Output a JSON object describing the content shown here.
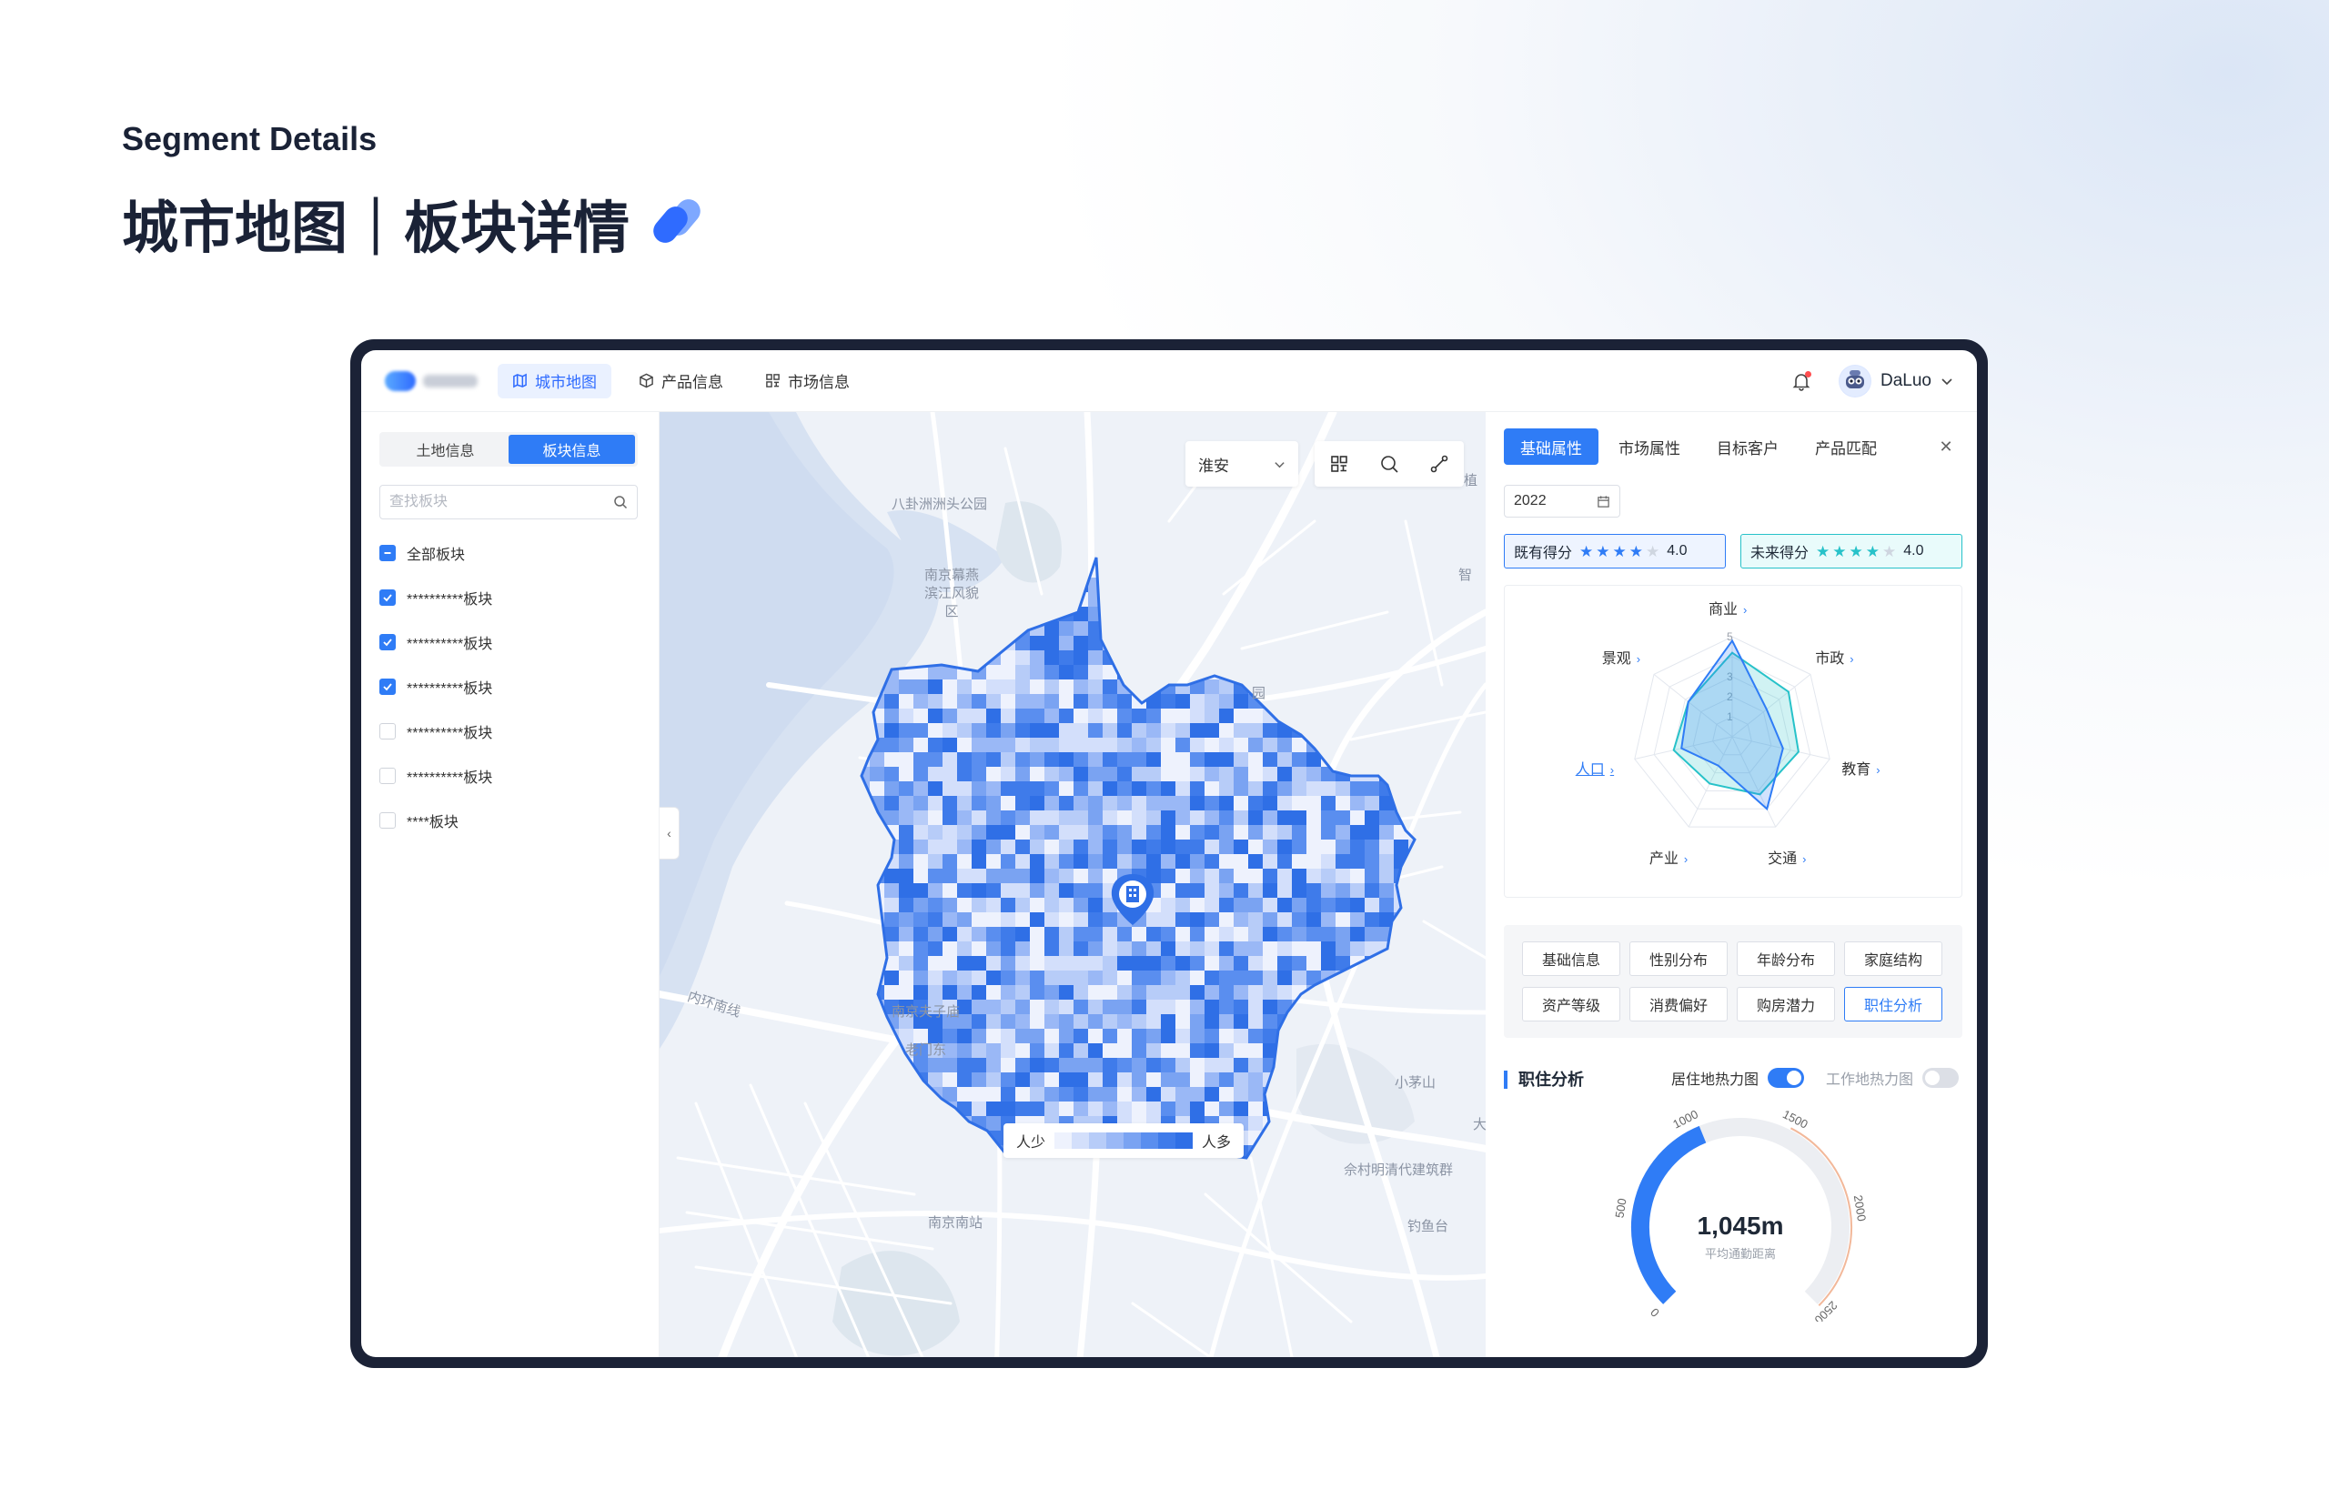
{
  "hero": {
    "subtitle": "Segment Details",
    "title": "城市地图｜板块详情"
  },
  "topnav": {
    "items": [
      {
        "label": "城市地图",
        "icon": "map-icon",
        "active": true
      },
      {
        "label": "产品信息",
        "icon": "cube-icon",
        "active": false
      },
      {
        "label": "市场信息",
        "icon": "grid-icon",
        "active": false
      }
    ],
    "user": "DaLuo"
  },
  "left": {
    "tabs": [
      "土地信息",
      "板块信息"
    ],
    "active_tab": 1,
    "search_placeholder": "查找板块",
    "checkboxes": [
      {
        "label": "全部板块",
        "state": "partial"
      },
      {
        "label": "**********板块",
        "state": "checked"
      },
      {
        "label": "**********板块",
        "state": "checked"
      },
      {
        "label": "**********板块",
        "state": "checked"
      },
      {
        "label": "**********板块",
        "state": "unchecked"
      },
      {
        "label": "**********板块",
        "state": "unchecked"
      },
      {
        "label": "****板块",
        "state": "unchecked"
      }
    ]
  },
  "map": {
    "city": "淮安",
    "labels": [
      "八卦洲洲头公园",
      "南京幕燕滨江风貌区",
      "内环南线",
      "南京夫子庙",
      "老门东",
      "南京南站",
      "小茅山",
      "佘村明清代建筑群",
      "钓鱼台",
      "园",
      "智",
      "植",
      "大"
    ],
    "legend": {
      "low": "人少",
      "high": "人多",
      "colors": [
        "#eef2fd",
        "#d3dffb",
        "#b7ccf8",
        "#9ab8f6",
        "#7aa3f2",
        "#5a8eef",
        "#3f7bea",
        "#2f6fe6"
      ]
    }
  },
  "right": {
    "tabs": [
      "基础属性",
      "市场属性",
      "目标客户",
      "产品匹配"
    ],
    "active_tab": 0,
    "year": "2022",
    "scores": [
      {
        "label": "既有得分",
        "stars": 4,
        "value": "4.0",
        "color": "#2f7cf6"
      },
      {
        "label": "未来得分",
        "stars": 4,
        "value": "4.0",
        "color": "#27c2c9"
      }
    ],
    "radar": {
      "axes": [
        "商业",
        "市政",
        "教育",
        "交通",
        "产业",
        "人口",
        "景观"
      ],
      "ticks": [
        "5",
        "3",
        "2",
        "1"
      ],
      "active_axis": 5,
      "series": [
        {
          "name": "既有得分",
          "color": "#2f7cf6",
          "values": [
            4.8,
            2.2,
            2.6,
            4.0,
            1.6,
            2.6,
            2.8
          ]
        },
        {
          "name": "未来得分",
          "color": "#27c2c9",
          "values": [
            4.2,
            3.6,
            3.4,
            3.2,
            2.6,
            3.0,
            2.8
          ]
        }
      ]
    },
    "categories": [
      "基础信息",
      "性别分布",
      "年龄分布",
      "家庭结构",
      "资产等级",
      "消费偏好",
      "购房潜力",
      "职住分析"
    ],
    "active_category": 7,
    "section": {
      "title": "职住分析",
      "toggle_on": "居住地热力图",
      "toggle_off": "工作地热力图"
    },
    "gauge": {
      "value": 1045,
      "display": "1,045m",
      "caption": "平均通勤距离",
      "max": 2500,
      "ticks": [
        "0",
        "500",
        "1000",
        "1500",
        "2000",
        "2500"
      ]
    }
  }
}
